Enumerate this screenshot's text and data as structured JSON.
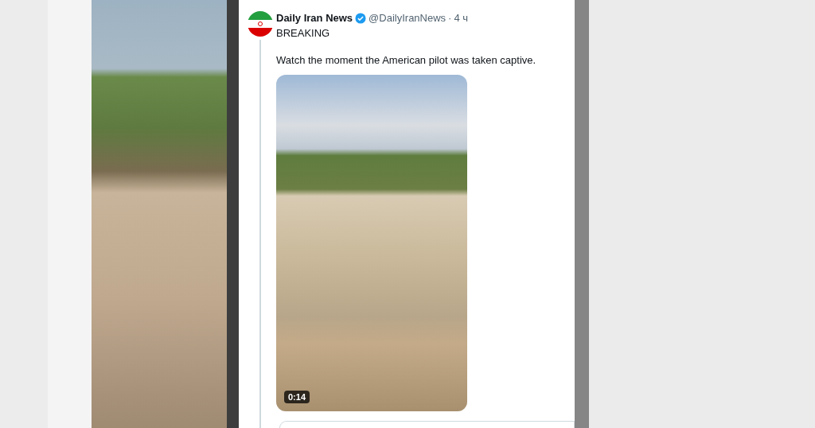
{
  "tweet": {
    "author": "Daily Iran News",
    "verified": true,
    "handle": "@DailyIranNews",
    "separator": "·",
    "time": "4 ч",
    "lines": [
      "BREAKING",
      "Watch the moment the American pilot was taken captive."
    ],
    "video": {
      "duration": "0:14"
    }
  }
}
